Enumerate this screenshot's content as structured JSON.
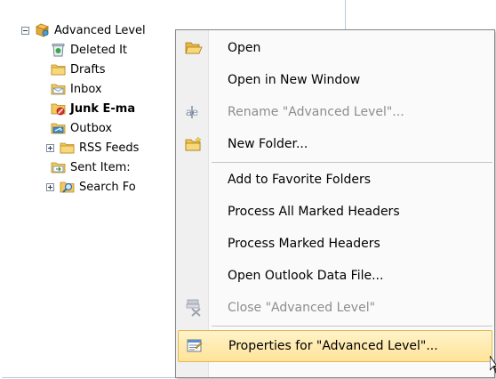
{
  "tree": [
    {
      "id": "advanced",
      "label": "Advanced Level",
      "expander": "minus",
      "icon": "pst-root-icon",
      "bold": false
    },
    {
      "id": "deleted",
      "label": "Deleted It",
      "icon": "deleted-items-icon",
      "bold": false
    },
    {
      "id": "drafts",
      "label": "Drafts",
      "icon": "folder-icon",
      "bold": false
    },
    {
      "id": "inbox",
      "label": "Inbox",
      "icon": "inbox-icon",
      "bold": false
    },
    {
      "id": "junk",
      "label": "Junk E-ma",
      "icon": "junk-email-icon",
      "bold": true
    },
    {
      "id": "outbox",
      "label": "Outbox",
      "icon": "outbox-icon",
      "bold": false
    },
    {
      "id": "rss",
      "label": "RSS Feeds",
      "expander": "plus",
      "icon": "folder-icon",
      "bold": false
    },
    {
      "id": "sent",
      "label": "Sent Item:",
      "icon": "sent-items-icon",
      "bold": false
    },
    {
      "id": "search",
      "label": "Search Fo",
      "expander": "plus",
      "icon": "search-folders-icon",
      "bold": false
    }
  ],
  "menu": {
    "items": [
      {
        "id": "open",
        "label": "Open",
        "icon": "open-folder-icon",
        "disabled": false,
        "hover": false
      },
      {
        "id": "open-new-window",
        "label": "Open in New Window",
        "icon": "",
        "disabled": false,
        "hover": false
      },
      {
        "id": "rename",
        "label": "Rename \"Advanced Level\"...",
        "icon": "rename-icon",
        "disabled": true,
        "hover": false
      },
      {
        "id": "new-folder",
        "label": "New Folder...",
        "icon": "new-folder-icon",
        "disabled": false,
        "hover": false
      },
      {
        "id": "add-favorites",
        "label": "Add to Favorite Folders",
        "icon": "",
        "disabled": false,
        "hover": false
      },
      {
        "id": "process-all",
        "label": "Process All Marked Headers",
        "icon": "",
        "disabled": false,
        "hover": false
      },
      {
        "id": "process-marked",
        "label": "Process Marked Headers",
        "icon": "",
        "disabled": false,
        "hover": false
      },
      {
        "id": "open-data-file",
        "label": "Open Outlook Data File...",
        "icon": "",
        "disabled": false,
        "hover": false
      },
      {
        "id": "close",
        "label": "Close \"Advanced Level\"",
        "icon": "close-data-file-icon",
        "disabled": true,
        "hover": false
      },
      {
        "id": "properties",
        "label": "Properties for \"Advanced Level\"...",
        "icon": "properties-icon",
        "disabled": false,
        "hover": true
      }
    ]
  }
}
